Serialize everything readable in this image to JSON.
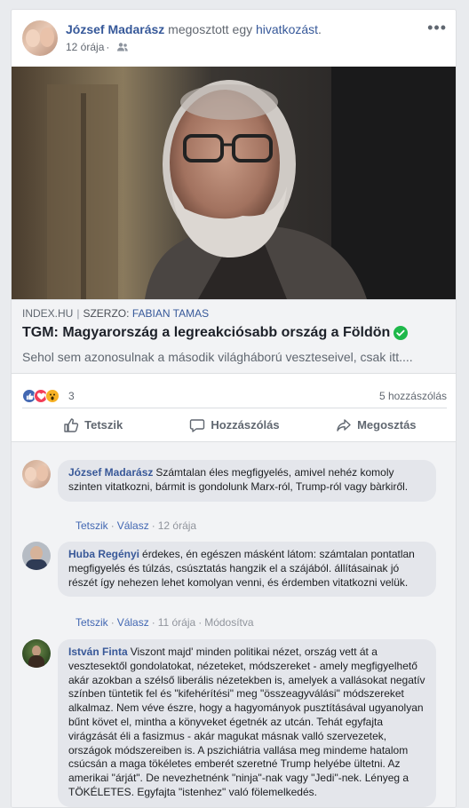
{
  "post": {
    "author": "József Madarász",
    "shared_text": "megosztott egy",
    "link_word": "hivatkozást",
    "period": ".",
    "time": "12 órája",
    "audience_icon": "friends-icon",
    "more_icon": "more-icon",
    "more_glyph": "•••"
  },
  "link": {
    "source": "INDEX.HU",
    "author_prefix": "SZERZO:",
    "author": "FABIAN TAMAS",
    "title": "TGM: Magyarország a legreakciósabb ország a Földön",
    "description": "Sehol sem azonosulnak a második világháború veszteseivel, csak itt...."
  },
  "reactions": {
    "types": [
      "like",
      "love",
      "wow"
    ],
    "count": "3",
    "comments_count": "5 hozzászólás"
  },
  "actions": {
    "like": "Tetszik",
    "comment": "Hozzászólás",
    "share": "Megosztás"
  },
  "comments": [
    {
      "name": "József Madarász",
      "text": "Számtalan éles megfigyelés, amivel nehéz komoly szinten vitatkozni, bármit is gondolunk Marx-ról, Trump-ról vagy bàrkiről.",
      "like": "Tetszik",
      "reply": "Válasz",
      "time": "12 órája",
      "edited": ""
    },
    {
      "name": "Huba Regényi",
      "text": "érdekes, én egészen másként látom: számtalan pontatlan megfigyelés és túlzás, csúsztatás hangzik el a szájából. állításainak jó részét így nehezen lehet komolyan venni, és érdemben vitatkozni velük.",
      "like": "Tetszik",
      "reply": "Válasz",
      "time": "11 órája",
      "edited": "Módosítva"
    },
    {
      "name": "István Finta",
      "text": "Viszont majd' minden politikai nézet, ország vett át a vesztesektől gondolatokat, nézeteket, módszereket - amely megfigyelhető akár azokban a szélső liberális nézetekben is, amelyek a vallásokat negatív színben tüntetik fel és \"kifehérítési\" meg \"összeagyválási\" módszereket alkalmaz. Nem véve észre, hogy a hagyományok pusztításával ugyanolyan bűnt követ el, mintha a könyveket égetnék az utcán. Tehát egyfajta virágzását éli a fasizmus - akár magukat másnak valló szervezetek, országok módszereiben is. A pszichiátria vallása meg mindeme hatalom csúcsán a maga tökéletes emberét szeretné Trump helyébe ültetni. Az amerikai \"árját\". De nevezhetnénk \"ninja\"-nak vagy \"Jedi\"-nek. Lényeg a TÖKÉLETES. Egyfajta \"istenhez\" való fölemelkedés."
    }
  ],
  "colors": {
    "link_blue": "#365899",
    "action_blue": "#4267b2",
    "like_blue": "#4267b2",
    "love_red": "#f33e58",
    "wow_yellow": "#f7b125",
    "verified_green": "#1eb84a"
  }
}
